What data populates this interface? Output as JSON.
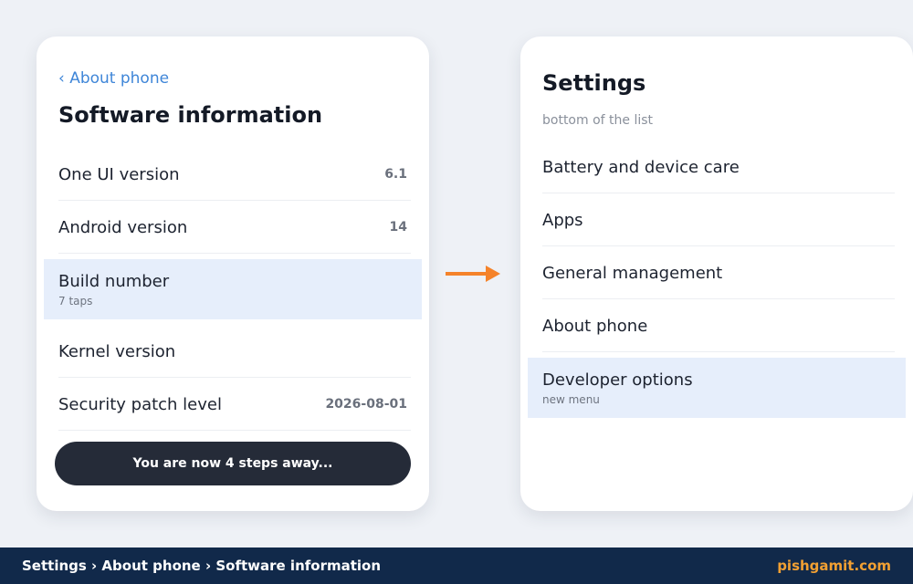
{
  "colors": {
    "accent_link": "#3f86d8",
    "highlight_row": "#e6eefb",
    "toast_bg": "#252b38",
    "arrow": "#f5832a",
    "footer_bg": "#11294a",
    "footer_brand": "#f2a032"
  },
  "left_panel": {
    "back_label": "‹ About phone",
    "title": "Software information",
    "rows": [
      {
        "label": "One UI version",
        "value": "6.1"
      },
      {
        "label": "Android version",
        "value": "14"
      },
      {
        "label": "Build number",
        "sub": "7 taps"
      },
      {
        "label": "Kernel version"
      },
      {
        "label": "Security patch level",
        "value": "2026-08-01"
      }
    ],
    "toast": "You are now 4 steps away..."
  },
  "arrow_icon": "right-arrow-icon",
  "right_panel": {
    "title": "Settings",
    "subtitle": "bottom of the list",
    "rows": [
      {
        "label": "Battery and device care"
      },
      {
        "label": "Apps"
      },
      {
        "label": "General management"
      },
      {
        "label": "About phone"
      },
      {
        "label": "Developer options",
        "sub": "new menu"
      }
    ]
  },
  "footer": {
    "breadcrumb": "Settings › About phone › Software information",
    "brand": "pishgamit.com"
  }
}
